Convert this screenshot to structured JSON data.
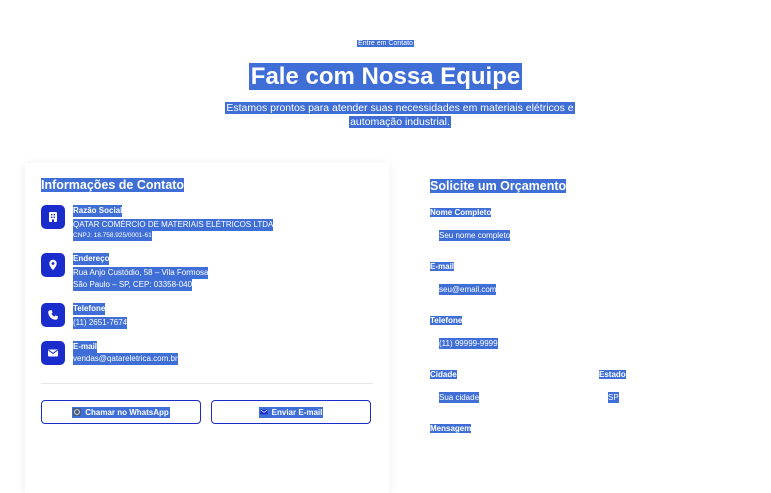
{
  "hero": {
    "eyebrow": "Entre em Contato",
    "title": "Fale com Nossa Equipe",
    "subtitle_line1": "Estamos prontos para atender suas necessidades em materiais elétricos e",
    "subtitle_line2": "automação industrial."
  },
  "contact_info": {
    "title": "Informações de Contato",
    "company": {
      "icon": "building-icon",
      "label": "Razão Social",
      "name": "QATAR COMÉRCIO DE MATERIAIS ELÉTRICOS LTDA",
      "cnpj": "CNPJ: 18.758.925/0001-61"
    },
    "address": {
      "icon": "location-pin-icon",
      "label": "Endereço",
      "line1": "Rua Anjo Custódio, 58 – Vila Formosa",
      "line2": "São Paulo – SP, CEP: 03358-040"
    },
    "phone": {
      "icon": "phone-icon",
      "label": "Telefone",
      "value": "(11) 2651-7674"
    },
    "email": {
      "icon": "envelope-icon",
      "label": "E-mail",
      "value": "vendas@qatareletrica.com.br"
    },
    "whatsapp_button": "Chamar no WhatsApp",
    "email_button": "Enviar E-mail"
  },
  "quote_form": {
    "title": "Solicite um Orçamento",
    "name_label": "Nome Completo",
    "name_placeholder": "Seu nome completo",
    "email_label": "E-mail",
    "email_placeholder": "seu@email.com",
    "phone_label": "Telefone",
    "phone_placeholder": "(11) 99999-9999",
    "city_label": "Cidade",
    "city_placeholder": "Sua cidade",
    "state_label": "Estado",
    "state_placeholder": "SP",
    "message_label": "Mensagem"
  },
  "colors": {
    "accent": "#1a2ccc",
    "selection": "#3f6fd6"
  }
}
